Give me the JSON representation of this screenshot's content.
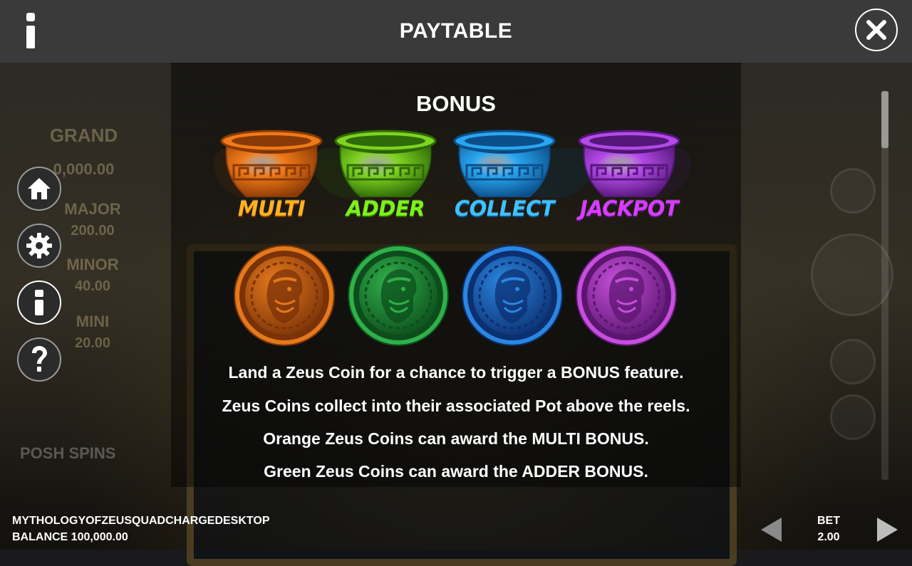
{
  "header": {
    "title": "PAYTABLE",
    "info_icon": "info-icon",
    "close_icon": "close-icon"
  },
  "side_menu": [
    {
      "name": "home",
      "icon": "home-icon"
    },
    {
      "name": "settings",
      "icon": "gear-icon"
    },
    {
      "name": "info",
      "icon": "info-icon",
      "active": true
    },
    {
      "name": "help",
      "icon": "question-icon"
    }
  ],
  "background": {
    "jackpots": [
      {
        "label": "GRAND",
        "value": "0,000.00"
      },
      {
        "label": "MAJOR",
        "value": "200.00"
      },
      {
        "label": "MINOR",
        "value": "40.00"
      },
      {
        "label": "MINI",
        "value": "20.00"
      }
    ],
    "posh_spins": "POSH SPINS"
  },
  "section": {
    "title": "BONUS",
    "pots": [
      {
        "label": "MULTI",
        "color": "#f07a18",
        "dark": "#8a3a06",
        "text_color": "#ffb21e"
      },
      {
        "label": "ADDER",
        "color": "#7ed321",
        "dark": "#2f6a08",
        "text_color": "#7cf21a"
      },
      {
        "label": "COLLECT",
        "color": "#2aa6f0",
        "dark": "#0b4f8a",
        "text_color": "#3fc1ff"
      },
      {
        "label": "JACKPOT",
        "color": "#b44ae8",
        "dark": "#55177a",
        "text_color": "#d83cff"
      }
    ],
    "coins": [
      {
        "name": "orange-zeus-coin",
        "color": "#e5791b",
        "dark": "#7a3208"
      },
      {
        "name": "green-zeus-coin",
        "color": "#2fb04a",
        "dark": "#0d4d1c"
      },
      {
        "name": "blue-zeus-coin",
        "color": "#2a86e0",
        "dark": "#0c2f70"
      },
      {
        "name": "purple-zeus-coin",
        "color": "#c64fdc",
        "dark": "#5c1670"
      }
    ],
    "descriptions": [
      "Land a Zeus Coin for a chance to trigger a BONUS feature.",
      "Zeus Coins collect into their associated Pot above the reels.",
      "Orange Zeus Coins can award the MULTI BONUS.",
      "Green Zeus Coins can award the ADDER BONUS."
    ]
  },
  "footer": {
    "game_name": "MYTHOLOGYOFZEUSQUADCHARGEDESKTOP",
    "balance": "BALANCE 100,000.00",
    "bet_label": "BET",
    "bet_value": "2.00",
    "prev_icon": "triangle-left-icon",
    "next_icon": "triangle-right-icon"
  }
}
